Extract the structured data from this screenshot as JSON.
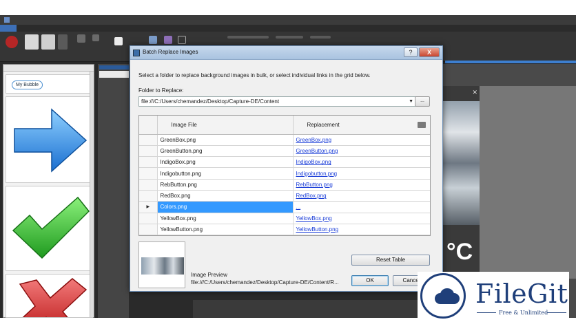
{
  "dialog": {
    "title": "Batch Replace Images",
    "help_label": "?",
    "close_label": "X",
    "intro": "Select a folder to replace background images in bulk, or select individual links in the grid below.",
    "folder_label": "Folder to Replace:",
    "folder_path": "file:///C:/Users/chemandez/Desktop/Capture-DE/Content",
    "browse_label": "...",
    "grid": {
      "columns": [
        "Image File",
        "Replacement"
      ],
      "rows": [
        {
          "file": "GreenBox.png",
          "replacement": "GreenBox.png"
        },
        {
          "file": "GreenButton.png",
          "replacement": "GreenButton.png"
        },
        {
          "file": "IndigoBox.png",
          "replacement": "IndigoBox.png"
        },
        {
          "file": "Indigobutton.png",
          "replacement": "Indigobutton.png"
        },
        {
          "file": "RebButton.png",
          "replacement": "RebButton.png"
        },
        {
          "file": "RedBox.png",
          "replacement": "RedBox.png"
        },
        {
          "file": "Colors.png",
          "replacement": "..."
        },
        {
          "file": "YellowBox.png",
          "replacement": "YellowBox.png"
        },
        {
          "file": "YellowButton.png",
          "replacement": "YellowButton.png"
        }
      ],
      "selected_row": 6
    },
    "reset_label": "Reset Table",
    "preview_label": "Image Preview",
    "preview_path": "file:///C:/Users/chemandez/Desktop/Capture-DE/Content/R...",
    "ok_label": "OK",
    "cancel_label": "Cancel"
  },
  "background_app": {
    "left_panel_bubble": "My Bubble",
    "weather_temp": "°C"
  },
  "watermark": {
    "name": "FileGit",
    "tagline": "Free & Unlimited"
  }
}
